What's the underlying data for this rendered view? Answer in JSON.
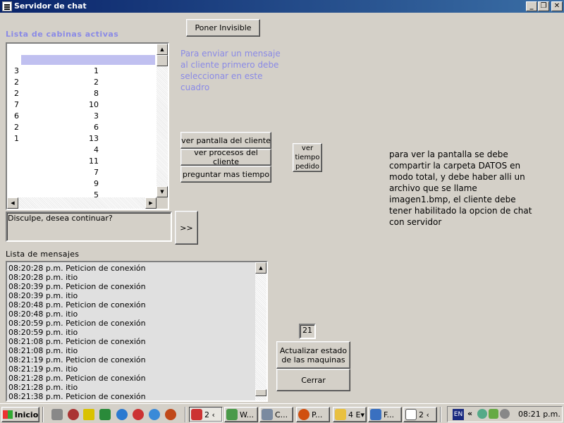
{
  "window": {
    "title": "Servidor de chat",
    "min_label": "_",
    "max_label": "❐",
    "close_label": "✕"
  },
  "cabins": {
    "title": "Lista de cabinas activas",
    "rows": [
      {
        "a": "3",
        "b": "1"
      },
      {
        "a": "2",
        "b": "2"
      },
      {
        "a": "2",
        "b": "8"
      },
      {
        "a": "7",
        "b": "10"
      },
      {
        "a": "6",
        "b": "3"
      },
      {
        "a": "2",
        "b": "6"
      },
      {
        "a": "1",
        "b": "13"
      },
      {
        "a": "",
        "b": "4"
      },
      {
        "a": "",
        "b": "11"
      },
      {
        "a": "",
        "b": "7"
      },
      {
        "a": "",
        "b": "9"
      },
      {
        "a": "",
        "b": "5"
      }
    ]
  },
  "buttons": {
    "invisible": "Poner Invisible",
    "view_screen": "ver pantalla del cliente",
    "view_processes": "ver procesos del cliente",
    "ask_time": "preguntar mas tiempo",
    "view_time": "ver tiempo pedido",
    "send": ">>",
    "update": "Actualizar estado de las maquinas",
    "close": "Cerrar"
  },
  "hint_blue": "Para enviar un mensaje al cliente primero debe seleccionar en este cuadro",
  "hint_black": "para ver la pantalla se debe compartir la carpeta DATOS en modo total, y debe haber alli un archivo que se llame imagen1.bmp, el cliente debe tener habilitado la opcion de chat con servidor",
  "message_input": "Disculpe, desea continuar?",
  "counter": "21",
  "messages": {
    "title": "Lista de mensajes",
    "items": [
      "08:20:28 p.m. Peticion de conexión",
      "08:20:28 p.m. itio",
      "08:20:39 p.m. Peticion de conexión",
      "08:20:39 p.m. itio",
      "08:20:48 p.m. Peticion de conexión",
      "08:20:48 p.m. itio",
      "08:20:59 p.m. Peticion de conexión",
      "08:20:59 p.m. itio",
      "08:21:08 p.m. Peticion de conexión",
      "08:21:08 p.m. itio",
      "08:21:19 p.m. Peticion de conexión",
      "08:21:19 p.m. itio",
      "08:21:28 p.m. Peticion de conexión",
      "08:21:28 p.m. itio",
      "08:21:38 p.m. Peticion de conexión"
    ]
  },
  "taskbar": {
    "start": "Inicio",
    "tasks": [
      "2 ‹",
      "W...",
      "C...",
      "P...",
      "4 E▾",
      "F...",
      "2 ‹"
    ],
    "lang": "EN",
    "chevron": "«",
    "clock": "08:21 p.m."
  },
  "colors": {
    "accent_blue": "#8a8ae6",
    "titlebar": "#0a246a",
    "face": "#d4d0c8",
    "selection": "#c0c0f0"
  }
}
